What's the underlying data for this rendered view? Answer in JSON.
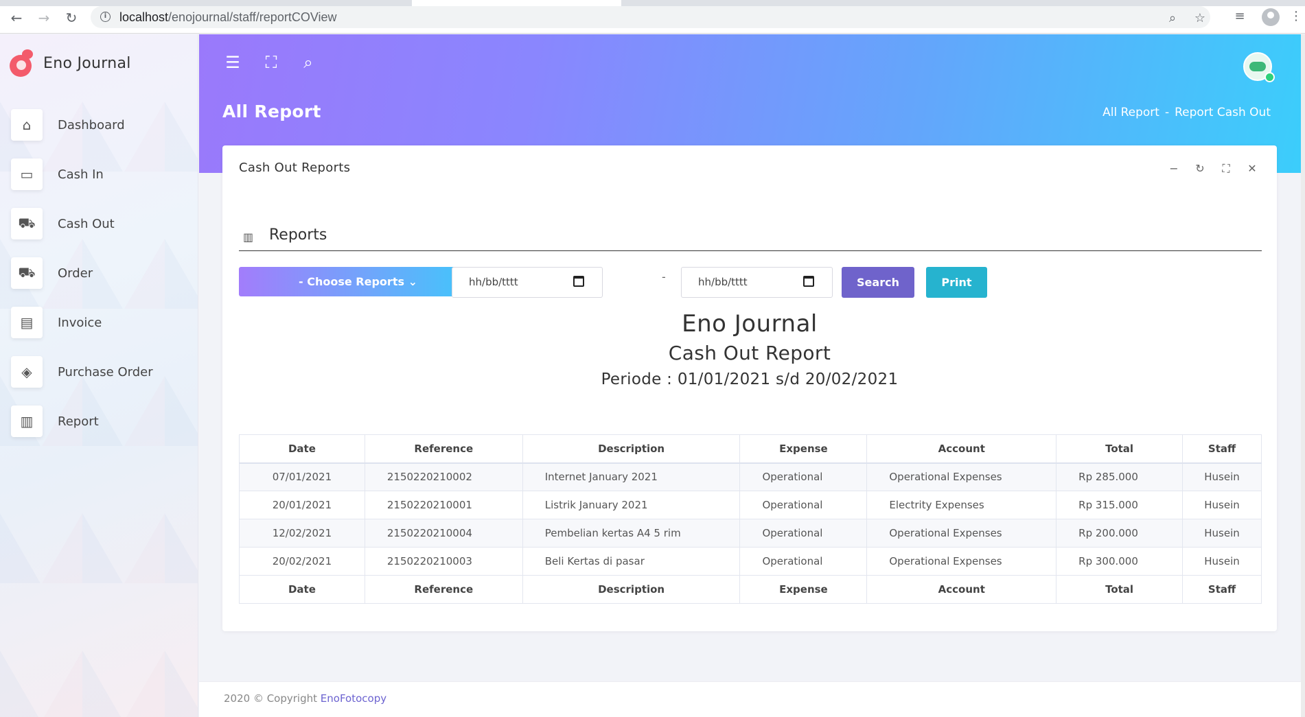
{
  "browser": {
    "url_host": "localhost",
    "url_path": "/enojournal/staff/reportCOView"
  },
  "sidebar": {
    "brand": "Eno Journal",
    "items": [
      {
        "label": "Dashboard",
        "icon": "home-icon"
      },
      {
        "label": "Cash In",
        "icon": "money-icon"
      },
      {
        "label": "Cash Out",
        "icon": "cart-icon"
      },
      {
        "label": "Order",
        "icon": "shopping-cart-icon"
      },
      {
        "label": "Invoice",
        "icon": "file-icon"
      },
      {
        "label": "Purchase Order",
        "icon": "layers-icon"
      },
      {
        "label": "Report",
        "icon": "bar-chart-icon"
      }
    ]
  },
  "header": {
    "title": "All Report",
    "breadcrumb": [
      "All Report",
      "-",
      "Report Cash Out"
    ]
  },
  "card": {
    "title": "Cash Out Reports",
    "section": "Reports",
    "choose_reports": "- Choose Reports",
    "date_from_placeholder": "hh/bb/tttt",
    "date_to_placeholder": "hh/bb/tttt",
    "date_separator": "-",
    "search_label": "Search",
    "print_label": "Print"
  },
  "report": {
    "company": "Eno Journal",
    "name": "Cash Out Report",
    "period": "Periode : 01/01/2021 s/d 20/02/2021",
    "columns": [
      "Date",
      "Reference",
      "Description",
      "Expense",
      "Account",
      "Total",
      "Staff"
    ],
    "rows": [
      [
        "07/01/2021",
        "2150220210002",
        "Internet January 2021",
        "Operational",
        "Operational Expenses",
        "Rp 285.000",
        "Husein"
      ],
      [
        "20/01/2021",
        "2150220210001",
        "Listrik January 2021",
        "Operational",
        "Electrity Expenses",
        "Rp 315.000",
        "Husein"
      ],
      [
        "12/02/2021",
        "2150220210004",
        "Pembelian kertas A4 5 rim",
        "Operational",
        "Operational Expenses",
        "Rp 200.000",
        "Husein"
      ],
      [
        "20/02/2021",
        "2150220210003",
        "Beli Kertas di pasar",
        "Operational",
        "Operational Expenses",
        "Rp 300.000",
        "Husein"
      ]
    ]
  },
  "footer": {
    "text": "2020 © Copyright",
    "link": "EnoFotocopy"
  },
  "colors": {
    "accent": "#6f63cb",
    "print": "#26b3cf",
    "header_start": "#9a79fb",
    "header_end": "#3bcefb"
  }
}
